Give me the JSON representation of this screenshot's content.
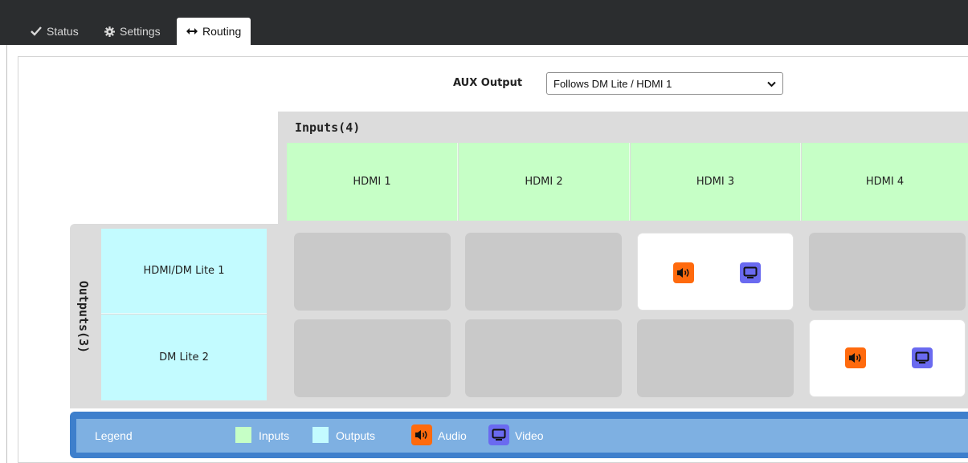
{
  "tabs": [
    {
      "label": "Status",
      "icon": "checkmark-icon"
    },
    {
      "label": "Settings",
      "icon": "gear-icon"
    },
    {
      "label": "Routing",
      "icon": "arrows-left-right-icon",
      "active": true
    }
  ],
  "aux": {
    "label": "AUX Output",
    "value": "Follows DM Lite / HDMI 1"
  },
  "inputs": {
    "title": "Inputs(4)",
    "items": [
      "HDMI 1",
      "HDMI 2",
      "HDMI 3",
      "HDMI 4"
    ]
  },
  "outputs": {
    "title": "Outputs(3)",
    "items": [
      "HDMI/DM Lite 1",
      "DM Lite 2"
    ]
  },
  "routes": [
    {
      "output": "HDMI/DM Lite 1",
      "input": "HDMI 3",
      "audio": true,
      "video": true
    },
    {
      "output": "DM Lite 2",
      "input": "HDMI 4",
      "audio": true,
      "video": true
    }
  ],
  "legend": {
    "title": "Legend",
    "inputs": "Inputs",
    "outputs": "Outputs",
    "audio": "Audio",
    "video": "Video"
  },
  "colors": {
    "input": "#c6ffc6",
    "output": "#c3fbff",
    "audio": "#ff6a0d",
    "video": "#6a6af0",
    "legend_bar": "#3e7fcc",
    "legend_inner": "#7eb0e2"
  }
}
